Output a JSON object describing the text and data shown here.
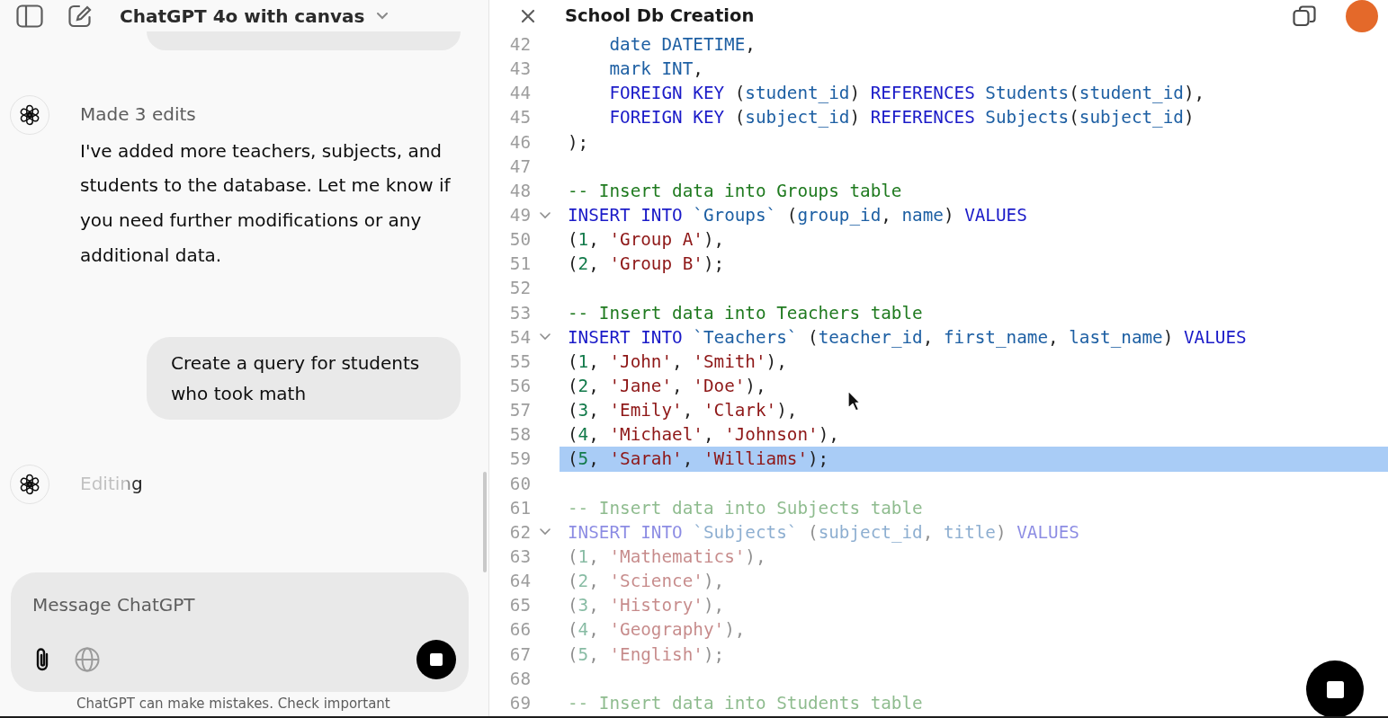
{
  "chat": {
    "model_title": "ChatGPT 4o with canvas",
    "messages": [
      {
        "kind": "user"
      },
      {
        "kind": "assistant",
        "status": "Made 3 edits",
        "streaming": false,
        "text": "I've added more teachers, subjects, and students to the database. Let me know if you need further modifications or any additional data."
      },
      {
        "kind": "user",
        "text": "Create a query for students who took math"
      },
      {
        "kind": "assistant",
        "status": "Editing",
        "streaming": true
      }
    ],
    "composer": {
      "placeholder": "Message ChatGPT",
      "tools": [
        {
          "kind": "attach",
          "disabled": false
        },
        {
          "kind": "web",
          "disabled": true
        }
      ],
      "generating": true
    },
    "disclaimer": "ChatGPT can make mistakes. Check important"
  },
  "canvas": {
    "title": "School Db Creation",
    "generating": true,
    "sections": [
      {
        "pending": false,
        "lines": [
          {
            "number": "42",
            "foldable": false,
            "selected": false,
            "tokens": [
              {
                "kind": "name",
                "text": "    date DATETIME"
              },
              {
                "kind": "plain",
                "text": ","
              }
            ]
          },
          {
            "number": "43",
            "foldable": false,
            "selected": false,
            "tokens": [
              {
                "kind": "name",
                "text": "    mark INT"
              },
              {
                "kind": "plain",
                "text": ","
              }
            ]
          },
          {
            "number": "44",
            "foldable": false,
            "selected": false,
            "tokens": [
              {
                "kind": "keyword",
                "text": "    FOREIGN KEY"
              },
              {
                "kind": "plain",
                "text": " ("
              },
              {
                "kind": "name",
                "text": "student_id"
              },
              {
                "kind": "plain",
                "text": ") "
              },
              {
                "kind": "keyword",
                "text": "REFERENCES"
              },
              {
                "kind": "name",
                "text": " Students"
              },
              {
                "kind": "plain",
                "text": "("
              },
              {
                "kind": "name",
                "text": "student_id"
              },
              {
                "kind": "plain",
                "text": "),"
              }
            ]
          },
          {
            "number": "45",
            "foldable": false,
            "selected": false,
            "tokens": [
              {
                "kind": "keyword",
                "text": "    FOREIGN KEY"
              },
              {
                "kind": "plain",
                "text": " ("
              },
              {
                "kind": "name",
                "text": "subject_id"
              },
              {
                "kind": "plain",
                "text": ") "
              },
              {
                "kind": "keyword",
                "text": "REFERENCES"
              },
              {
                "kind": "name",
                "text": " Subjects"
              },
              {
                "kind": "plain",
                "text": "("
              },
              {
                "kind": "name",
                "text": "subject_id"
              },
              {
                "kind": "plain",
                "text": ")"
              }
            ]
          },
          {
            "number": "46",
            "foldable": false,
            "selected": false,
            "tokens": [
              {
                "kind": "plain",
                "text": ");"
              }
            ]
          },
          {
            "number": "47",
            "foldable": false,
            "selected": false
          },
          {
            "number": "48",
            "foldable": false,
            "selected": false,
            "tokens": [
              {
                "kind": "comment",
                "text": "-- Insert data into Groups table"
              }
            ]
          },
          {
            "number": "49",
            "foldable": true,
            "selected": false,
            "tokens": [
              {
                "kind": "keyword",
                "text": "INSERT INTO"
              },
              {
                "kind": "name",
                "text": " `Groups`"
              },
              {
                "kind": "plain",
                "text": " ("
              },
              {
                "kind": "name",
                "text": "group_id"
              },
              {
                "kind": "plain",
                "text": ", "
              },
              {
                "kind": "name",
                "text": "name"
              },
              {
                "kind": "plain",
                "text": ") "
              },
              {
                "kind": "keyword",
                "text": "VALUES"
              }
            ]
          },
          {
            "number": "50",
            "foldable": false,
            "selected": false,
            "tokens": [
              {
                "kind": "plain",
                "text": "("
              },
              {
                "kind": "number",
                "text": "1"
              },
              {
                "kind": "plain",
                "text": ", "
              },
              {
                "kind": "string",
                "text": "'Group A'"
              },
              {
                "kind": "plain",
                "text": "),"
              }
            ]
          },
          {
            "number": "51",
            "foldable": false,
            "selected": false,
            "tokens": [
              {
                "kind": "plain",
                "text": "("
              },
              {
                "kind": "number",
                "text": "2"
              },
              {
                "kind": "plain",
                "text": ", "
              },
              {
                "kind": "string",
                "text": "'Group B'"
              },
              {
                "kind": "plain",
                "text": ");"
              }
            ]
          },
          {
            "number": "52",
            "foldable": false,
            "selected": false
          },
          {
            "number": "53",
            "foldable": false,
            "selected": false,
            "tokens": [
              {
                "kind": "comment",
                "text": "-- Insert data into Teachers table"
              }
            ]
          },
          {
            "number": "54",
            "foldable": true,
            "selected": false,
            "tokens": [
              {
                "kind": "keyword",
                "text": "INSERT INTO"
              },
              {
                "kind": "name",
                "text": " `Teachers`"
              },
              {
                "kind": "plain",
                "text": " ("
              },
              {
                "kind": "name",
                "text": "teacher_id"
              },
              {
                "kind": "plain",
                "text": ", "
              },
              {
                "kind": "name",
                "text": "first_name"
              },
              {
                "kind": "plain",
                "text": ", "
              },
              {
                "kind": "name",
                "text": "last_name"
              },
              {
                "kind": "plain",
                "text": ") "
              },
              {
                "kind": "keyword",
                "text": "VALUES"
              }
            ]
          },
          {
            "number": "55",
            "foldable": false,
            "selected": false,
            "tokens": [
              {
                "kind": "plain",
                "text": "("
              },
              {
                "kind": "number",
                "text": "1"
              },
              {
                "kind": "plain",
                "text": ", "
              },
              {
                "kind": "string",
                "text": "'John'"
              },
              {
                "kind": "plain",
                "text": ", "
              },
              {
                "kind": "string",
                "text": "'Smith'"
              },
              {
                "kind": "plain",
                "text": "),"
              }
            ]
          },
          {
            "number": "56",
            "foldable": false,
            "selected": false,
            "tokens": [
              {
                "kind": "plain",
                "text": "("
              },
              {
                "kind": "number",
                "text": "2"
              },
              {
                "kind": "plain",
                "text": ", "
              },
              {
                "kind": "string",
                "text": "'Jane'"
              },
              {
                "kind": "plain",
                "text": ", "
              },
              {
                "kind": "string",
                "text": "'Doe'"
              },
              {
                "kind": "plain",
                "text": "),"
              }
            ]
          },
          {
            "number": "57",
            "foldable": false,
            "selected": false,
            "tokens": [
              {
                "kind": "plain",
                "text": "("
              },
              {
                "kind": "number",
                "text": "3"
              },
              {
                "kind": "plain",
                "text": ", "
              },
              {
                "kind": "string",
                "text": "'Emily'"
              },
              {
                "kind": "plain",
                "text": ", "
              },
              {
                "kind": "string",
                "text": "'Clark'"
              },
              {
                "kind": "plain",
                "text": "),"
              }
            ]
          },
          {
            "number": "58",
            "foldable": false,
            "selected": false,
            "tokens": [
              {
                "kind": "plain",
                "text": "("
              },
              {
                "kind": "number",
                "text": "4"
              },
              {
                "kind": "plain",
                "text": ", "
              },
              {
                "kind": "string",
                "text": "'Michael'"
              },
              {
                "kind": "plain",
                "text": ", "
              },
              {
                "kind": "string",
                "text": "'Johnson'"
              },
              {
                "kind": "plain",
                "text": "),"
              }
            ]
          },
          {
            "number": "59",
            "foldable": false,
            "selected": true,
            "tokens": [
              {
                "kind": "plain",
                "text": "("
              },
              {
                "kind": "number",
                "text": "5"
              },
              {
                "kind": "plain",
                "text": ", "
              },
              {
                "kind": "string",
                "text": "'Sarah'"
              },
              {
                "kind": "plain",
                "text": ", "
              },
              {
                "kind": "string",
                "text": "'Williams'"
              },
              {
                "kind": "plain",
                "text": ");"
              }
            ]
          },
          {
            "number": "60",
            "foldable": false,
            "selected": false
          }
        ]
      },
      {
        "pending": true,
        "lines": [
          {
            "number": "61",
            "foldable": false,
            "selected": false,
            "tokens": [
              {
                "kind": "comment",
                "text": "-- Insert data into Subjects table"
              }
            ]
          },
          {
            "number": "62",
            "foldable": true,
            "selected": false,
            "tokens": [
              {
                "kind": "keyword",
                "text": "INSERT INTO"
              },
              {
                "kind": "name",
                "text": " `Subjects`"
              },
              {
                "kind": "plain",
                "text": " ("
              },
              {
                "kind": "name",
                "text": "subject_id"
              },
              {
                "kind": "plain",
                "text": ", "
              },
              {
                "kind": "name",
                "text": "title"
              },
              {
                "kind": "plain",
                "text": ") "
              },
              {
                "kind": "keyword",
                "text": "VALUES"
              }
            ]
          },
          {
            "number": "63",
            "foldable": false,
            "selected": false,
            "tokens": [
              {
                "kind": "plain",
                "text": "("
              },
              {
                "kind": "number",
                "text": "1"
              },
              {
                "kind": "plain",
                "text": ", "
              },
              {
                "kind": "string",
                "text": "'Mathematics'"
              },
              {
                "kind": "plain",
                "text": "),"
              }
            ]
          },
          {
            "number": "64",
            "foldable": false,
            "selected": false,
            "tokens": [
              {
                "kind": "plain",
                "text": "("
              },
              {
                "kind": "number",
                "text": "2"
              },
              {
                "kind": "plain",
                "text": ", "
              },
              {
                "kind": "string",
                "text": "'Science'"
              },
              {
                "kind": "plain",
                "text": "),"
              }
            ]
          },
          {
            "number": "65",
            "foldable": false,
            "selected": false,
            "tokens": [
              {
                "kind": "plain",
                "text": "("
              },
              {
                "kind": "number",
                "text": "3"
              },
              {
                "kind": "plain",
                "text": ", "
              },
              {
                "kind": "string",
                "text": "'History'"
              },
              {
                "kind": "plain",
                "text": "),"
              }
            ]
          },
          {
            "number": "66",
            "foldable": false,
            "selected": false,
            "tokens": [
              {
                "kind": "plain",
                "text": "("
              },
              {
                "kind": "number",
                "text": "4"
              },
              {
                "kind": "plain",
                "text": ", "
              },
              {
                "kind": "string",
                "text": "'Geography'"
              },
              {
                "kind": "plain",
                "text": "),"
              }
            ]
          },
          {
            "number": "67",
            "foldable": false,
            "selected": false,
            "tokens": [
              {
                "kind": "plain",
                "text": "("
              },
              {
                "kind": "number",
                "text": "5"
              },
              {
                "kind": "plain",
                "text": ", "
              },
              {
                "kind": "string",
                "text": "'English'"
              },
              {
                "kind": "plain",
                "text": ");"
              }
            ]
          },
          {
            "number": "68",
            "foldable": false,
            "selected": false
          },
          {
            "number": "69",
            "foldable": false,
            "selected": false,
            "tokens": [
              {
                "kind": "comment",
                "text": "-- Insert data into Students table"
              }
            ]
          }
        ]
      }
    ]
  }
}
